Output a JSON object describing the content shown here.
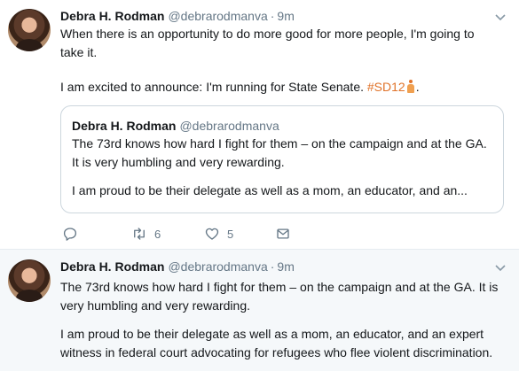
{
  "tweets": [
    {
      "author_name": "Debra H. Rodman",
      "handle": "@debrarodmanva",
      "separator": "·",
      "time": "9m",
      "text_lines": [
        "When there is an opportunity to do more good for more people, I'm going to",
        "take it."
      ],
      "text_p2_prefix": "I am excited to announce: I'm running for State Senate. ",
      "hashtag": "#SD12",
      "emoji_icon": "woman-walking-emoji",
      "trailing": ".",
      "quote": {
        "author_name": "Debra H. Rodman",
        "handle": "@debrarodmanva",
        "p1_line1": "The 73rd knows how hard I fight for them – on the campaign and at the GA.",
        "p1_line2": "It is very humbling and very rewarding.",
        "p2": "I am proud to be their delegate as well as a mom, an educator, and an..."
      },
      "actions": {
        "reply_icon": "reply-icon",
        "retweet_count": "6",
        "like_count": "5",
        "dm_icon": "mail-icon"
      }
    },
    {
      "author_name": "Debra H. Rodman",
      "handle": "@debrarodmanva",
      "separator": "·",
      "time": "9m",
      "p1_line1": "The 73rd knows how hard I fight for them – on the campaign and at the GA. It is",
      "p1_line2": "very humbling and very rewarding.",
      "p2_line1": "I am proud to be their delegate as well as a mom, an educator, and an expert",
      "p2_line2": "witness in federal court advocating for refugees who flee violent discrimination."
    }
  ],
  "colors": {
    "accent_hashtag": "#e0732a",
    "muted": "#657786",
    "border": "#e6ecf0",
    "highlight_bg": "#f5f8fa"
  }
}
